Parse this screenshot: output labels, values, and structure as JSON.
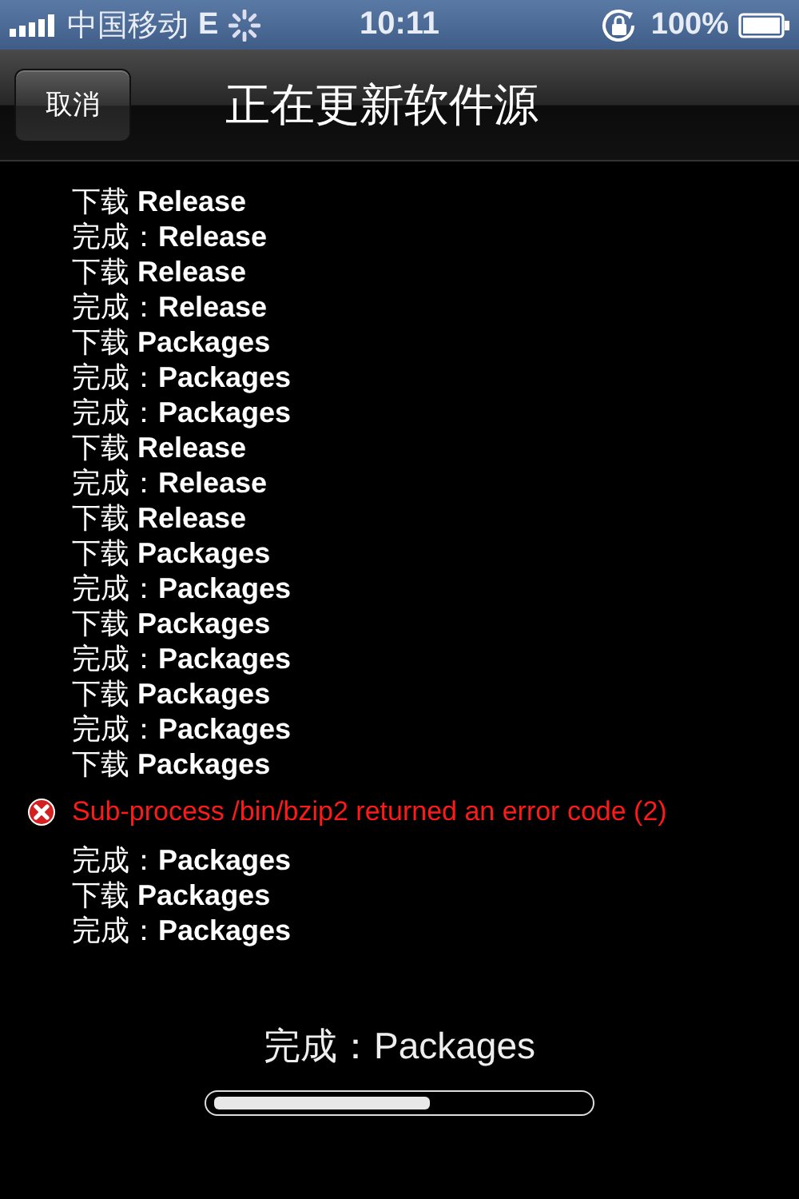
{
  "status_bar": {
    "carrier": "中国移动",
    "network": "E",
    "time": "10:11",
    "battery": "100%"
  },
  "nav_bar": {
    "title": "正在更新软件源",
    "cancel_button": "取消"
  },
  "log": [
    {
      "kind": "line",
      "text": "下载 **Release**"
    },
    {
      "kind": "line",
      "text": "完成：**Release**"
    },
    {
      "kind": "line",
      "text": "下载 **Release**"
    },
    {
      "kind": "line",
      "text": "完成：**Release**"
    },
    {
      "kind": "line",
      "text": "下载 **Packages**"
    },
    {
      "kind": "line",
      "text": "完成：**Packages**"
    },
    {
      "kind": "line",
      "text": "完成：**Packages**"
    },
    {
      "kind": "line",
      "text": "下载 **Release**"
    },
    {
      "kind": "line",
      "text": "完成：**Release**"
    },
    {
      "kind": "line",
      "text": "下载 **Release**"
    },
    {
      "kind": "line",
      "text": "下载 **Packages**"
    },
    {
      "kind": "line",
      "text": "完成：**Packages**"
    },
    {
      "kind": "line",
      "text": "下载 **Packages**"
    },
    {
      "kind": "line",
      "text": "完成：**Packages**"
    },
    {
      "kind": "line",
      "text": "下载 **Packages**"
    },
    {
      "kind": "line",
      "text": "完成：**Packages**"
    },
    {
      "kind": "line",
      "text": "下载 **Packages**"
    },
    {
      "kind": "error",
      "text": "Sub-process /bin/bzip2 returned an error code (2)"
    },
    {
      "kind": "line",
      "text": "完成：**Packages**"
    },
    {
      "kind": "line",
      "text": "下载 **Packages**"
    },
    {
      "kind": "line",
      "text": "完成：**Packages**"
    }
  ],
  "progress": {
    "label": "完成：Packages",
    "level": 0.58
  }
}
